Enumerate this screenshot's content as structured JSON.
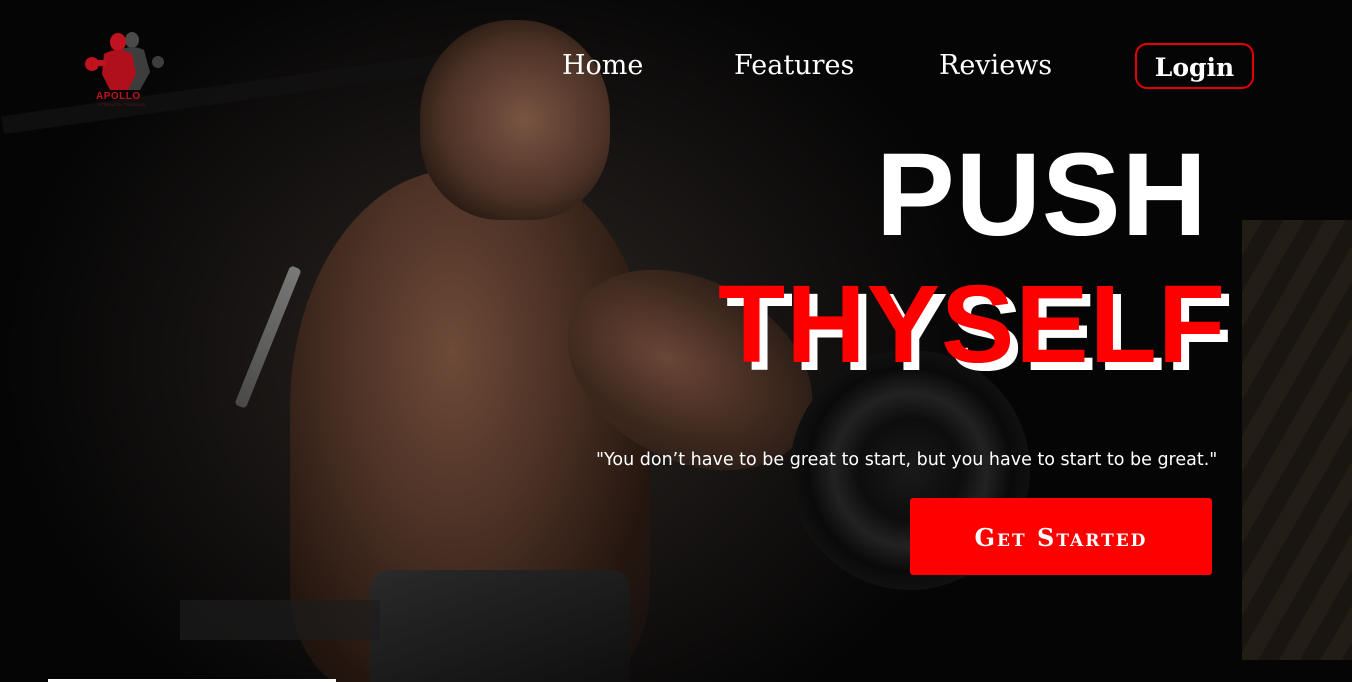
{
  "brand": {
    "name": "APOLLO",
    "tagline": "STRENGTH TRAINING",
    "accent": "#ff0000"
  },
  "nav": {
    "items": [
      {
        "label": "Home"
      },
      {
        "label": "Features"
      },
      {
        "label": "Reviews"
      }
    ],
    "login_label": "Login"
  },
  "hero": {
    "headline_line1": "PUSH",
    "headline_line2": "THYSELF",
    "quote": "\"You don’t have to be great to start, but you have to start to be great.\"",
    "cta_label": "Get Started",
    "background_image": "athlete-lifting-barbell-photo"
  }
}
